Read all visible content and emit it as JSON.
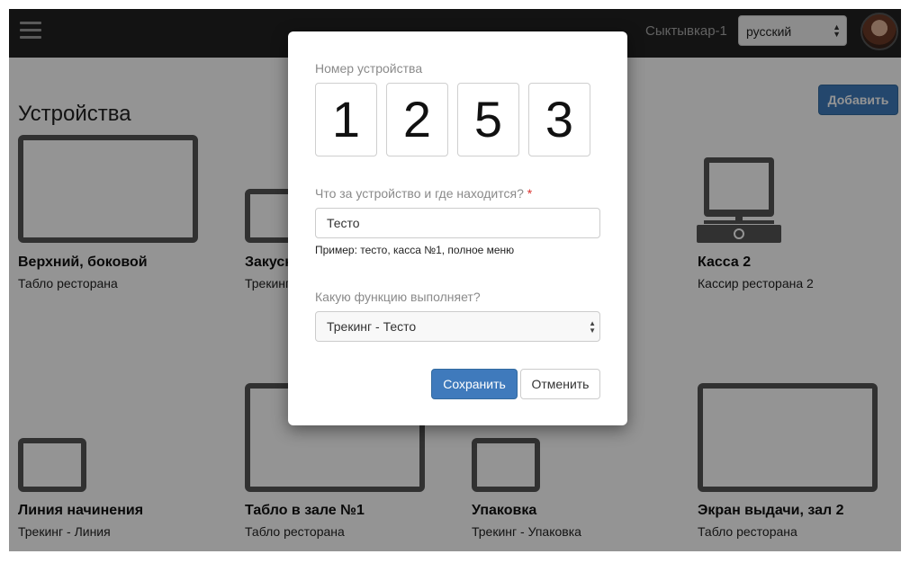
{
  "header": {
    "city": "Сыктывкар-1",
    "language": "русский"
  },
  "page": {
    "title": "Устройства",
    "add_label": "Добавить"
  },
  "devices": [
    {
      "name": "Верхний, боковой",
      "role": "Табло ресторана",
      "icon": "monitor-icon"
    },
    {
      "name": "Закуски",
      "role": "Трекинг - Закуски",
      "icon": "tablet-icon"
    },
    {
      "name": "Касса 2",
      "role": "Кассир ресторана 2",
      "icon": "cash-register-icon"
    },
    {
      "name": "Линия начинения",
      "role": "Трекинг - Линия",
      "icon": "tablet-icon"
    },
    {
      "name": "Табло в зале №1",
      "role": "Табло ресторана",
      "icon": "monitor-icon"
    },
    {
      "name": "Упаковка",
      "role": "Трекинг - Упаковка",
      "icon": "tablet-icon"
    },
    {
      "name": "Экран выдачи, зал 2",
      "role": "Табло ресторана",
      "icon": "monitor-icon"
    }
  ],
  "modal": {
    "device_number_label": "Номер устройства",
    "digits": [
      "1",
      "2",
      "5",
      "3"
    ],
    "description_label": "Что за устройство и где находится?",
    "required_mark": "*",
    "description_value": "Тесто",
    "description_help": "Пример: тесто, касса №1, полное меню",
    "function_label": "Какую функцию выполняет?",
    "function_value": "Трекинг - Тесто",
    "save_label": "Сохранить",
    "cancel_label": "Отменить"
  }
}
